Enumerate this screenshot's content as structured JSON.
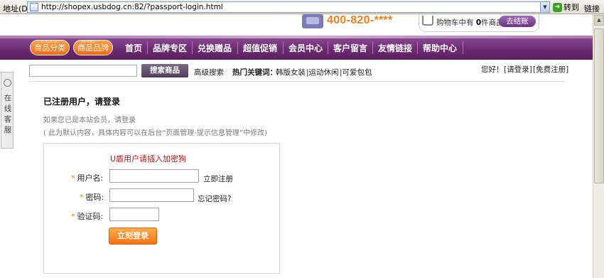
{
  "browser": {
    "address_label": "地址(D)",
    "url": "http://shopex.usbdog.cn:82/?passport-login.html",
    "go_label": "转到",
    "links_label": "链接"
  },
  "header": {
    "hotline": "400-820-****",
    "cart": {
      "prefix": "购物车中有 ",
      "count": "0",
      "suffix": "件商品",
      "checkout_label": "去结账"
    }
  },
  "nav": {
    "category_btn": "商品分类",
    "category_btn_small": "CATEGORY",
    "brand_btn": "商品品牌",
    "brand_btn_small": "BRAND",
    "items": [
      "首页",
      "品牌专区",
      "兑换赠品",
      "超值促销",
      "会员中心",
      "客户留言",
      "友情链接",
      "帮助中心"
    ]
  },
  "search": {
    "placeholder": "",
    "button": "搜索商品",
    "advanced": "高级搜索",
    "hot_label": "热门关键词：",
    "hot_keywords": [
      "韩版女装",
      "|运动休闲",
      "|可爱包包"
    ]
  },
  "account": {
    "greeting": "您好！",
    "login": "[请登录]",
    "register": "[免费注册]"
  },
  "side_tab": {
    "label": "在线客服"
  },
  "login": {
    "title": "已注册用户，请登录",
    "info_1": "如果您已是本站会员，请登录",
    "info_2": "( 此为默认内容，具体内容可以在后台“页面管理-提示信息管理”中修改)",
    "usb_notice": "U盾用户请插入加密狗",
    "req_mark": "*",
    "username_label": "用户名:",
    "username_link": "立即注册",
    "password_label": "密码:",
    "password_link": "忘记密码?",
    "captcha_label": "验证码:",
    "submit": "立刻登录"
  }
}
